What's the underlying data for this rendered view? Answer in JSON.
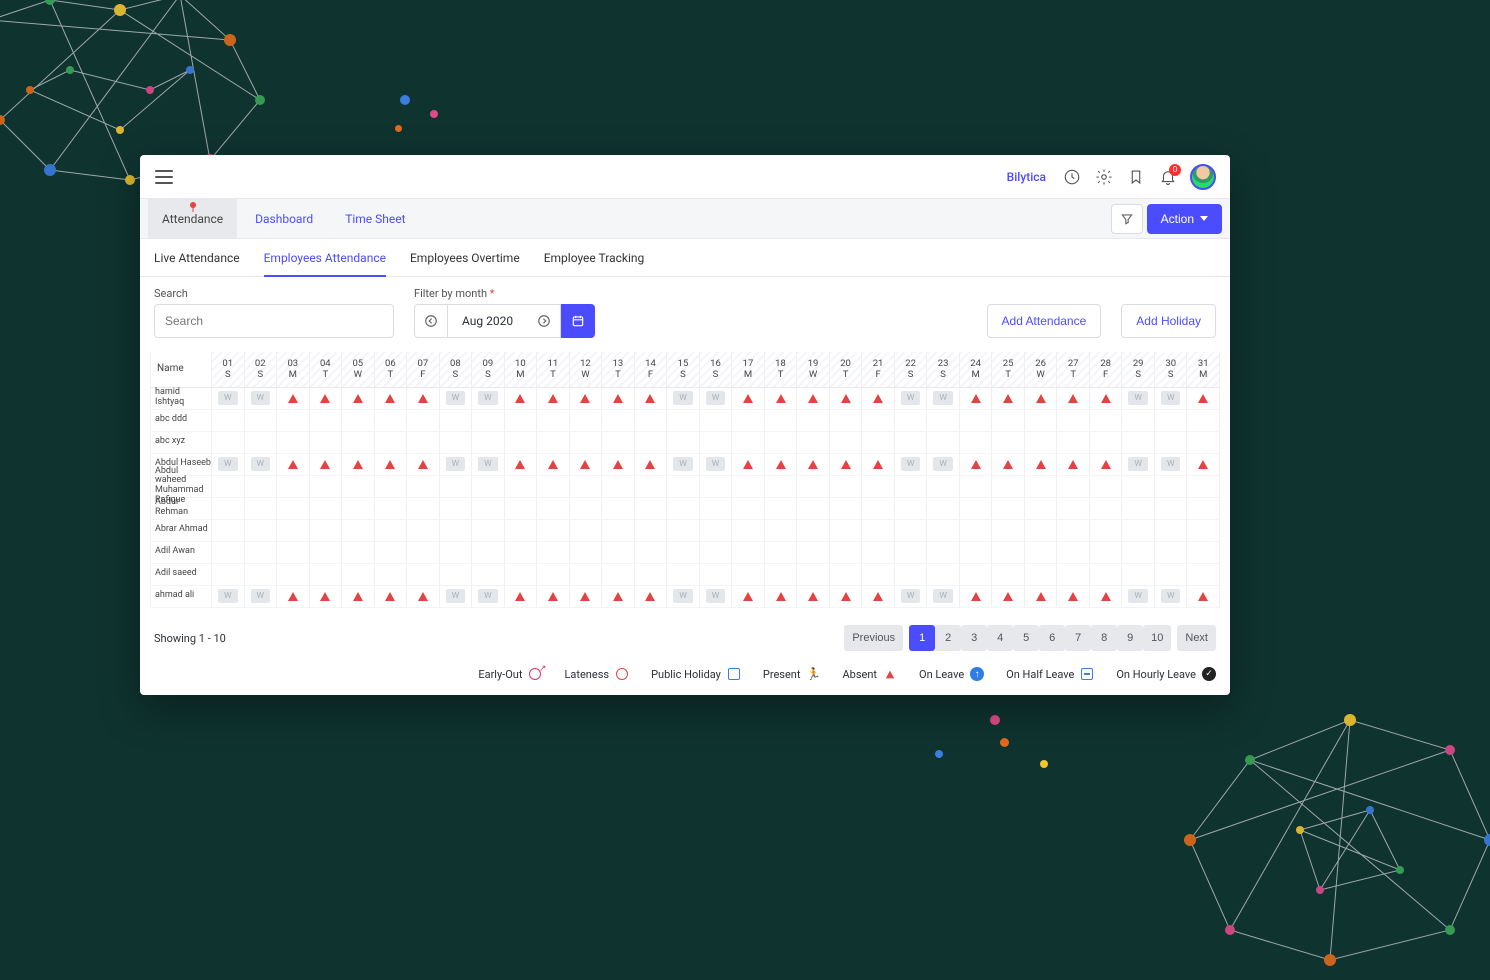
{
  "header": {
    "brand": "Bilytica",
    "notification_count": "0"
  },
  "tabs1": [
    {
      "label": "Attendance",
      "active": true
    },
    {
      "label": "Dashboard",
      "active": false
    },
    {
      "label": "Time Sheet",
      "active": false
    }
  ],
  "action_button": "Action",
  "tabs2": [
    {
      "label": "Live Attendance",
      "active": false
    },
    {
      "label": "Employees Attendance",
      "active": true
    },
    {
      "label": "Employees Overtime",
      "active": false
    },
    {
      "label": "Employee Tracking",
      "active": false
    }
  ],
  "filters": {
    "search_label": "Search",
    "search_placeholder": "Search",
    "month_label": "Filter by month",
    "month_value": "Aug 2020",
    "add_attendance": "Add Attendance",
    "add_holiday": "Add Holiday"
  },
  "table": {
    "name_header": "Name",
    "days": [
      {
        "d": "01",
        "w": "S"
      },
      {
        "d": "02",
        "w": "S"
      },
      {
        "d": "03",
        "w": "M"
      },
      {
        "d": "04",
        "w": "T"
      },
      {
        "d": "05",
        "w": "W"
      },
      {
        "d": "06",
        "w": "T"
      },
      {
        "d": "07",
        "w": "F"
      },
      {
        "d": "08",
        "w": "S"
      },
      {
        "d": "09",
        "w": "S"
      },
      {
        "d": "10",
        "w": "M"
      },
      {
        "d": "11",
        "w": "T"
      },
      {
        "d": "12",
        "w": "W"
      },
      {
        "d": "13",
        "w": "T"
      },
      {
        "d": "14",
        "w": "F"
      },
      {
        "d": "15",
        "w": "S"
      },
      {
        "d": "16",
        "w": "S"
      },
      {
        "d": "17",
        "w": "M"
      },
      {
        "d": "18",
        "w": "T"
      },
      {
        "d": "19",
        "w": "W"
      },
      {
        "d": "20",
        "w": "T"
      },
      {
        "d": "21",
        "w": "F"
      },
      {
        "d": "22",
        "w": "S"
      },
      {
        "d": "23",
        "w": "S"
      },
      {
        "d": "24",
        "w": "M"
      },
      {
        "d": "25",
        "w": "T"
      },
      {
        "d": "26",
        "w": "W"
      },
      {
        "d": "27",
        "w": "T"
      },
      {
        "d": "28",
        "w": "F"
      },
      {
        "d": "29",
        "w": "S"
      },
      {
        "d": "30",
        "w": "S"
      },
      {
        "d": "31",
        "w": "M"
      }
    ],
    "rows": [
      {
        "name": "hamid Ishtyaq",
        "pattern": "full"
      },
      {
        "name": "abc ddd",
        "pattern": "empty"
      },
      {
        "name": "abc xyz",
        "pattern": "empty"
      },
      {
        "name": "Abdul Haseeb",
        "pattern": "full"
      },
      {
        "name": "Abdul waheed Muhammad Rafique",
        "pattern": "empty"
      },
      {
        "name": "Abdur Rehman",
        "pattern": "empty"
      },
      {
        "name": "Abrar Ahmad",
        "pattern": "empty"
      },
      {
        "name": "Adil Awan",
        "pattern": "empty"
      },
      {
        "name": "Adil saeed",
        "pattern": "empty"
      },
      {
        "name": "ahmad ali",
        "pattern": "full"
      }
    ],
    "weekend_label": "W"
  },
  "footer": {
    "showing": "Showing 1 - 10",
    "prev": "Previous",
    "next": "Next",
    "pages": [
      "1",
      "2",
      "3",
      "4",
      "5",
      "6",
      "7",
      "8",
      "9",
      "10"
    ],
    "active_page": "1"
  },
  "legend": {
    "early_out": "Early-Out",
    "lateness": "Lateness",
    "public_holiday": "Public Holiday",
    "present": "Present",
    "absent": "Absent",
    "on_leave": "On Leave",
    "on_half_leave": "On Half Leave",
    "on_hourly_leave": "On Hourly Leave"
  }
}
